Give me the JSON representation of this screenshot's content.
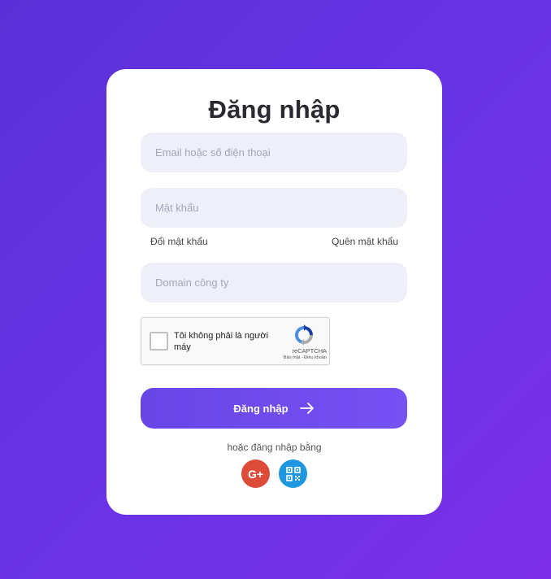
{
  "login": {
    "title": "Đăng nhập",
    "email_placeholder": "Email hoặc số điện thoại",
    "password_placeholder": "Mật khẩu",
    "change_password_link": "Đổi mật khẩu",
    "forgot_password_link": "Quên mật khẩu",
    "domain_placeholder": "Domain công ty",
    "submit_label": "Đăng nhập",
    "alt_login_text": "hoặc đăng nhập bằng"
  },
  "captcha": {
    "label": "Tôi không phải là người máy",
    "brand": "reCAPTCHA",
    "terms": "Bảo mật - Điều khoản"
  },
  "social": {
    "google_label": "G+",
    "google_color": "#dd4b39",
    "qr_color": "#1e97e0",
    "icons": [
      "google-plus-icon",
      "qr-code-icon"
    ]
  },
  "colors": {
    "background": "#6a33e6",
    "primary_button": "#7049ec",
    "input_bg": "#eeeff8"
  }
}
